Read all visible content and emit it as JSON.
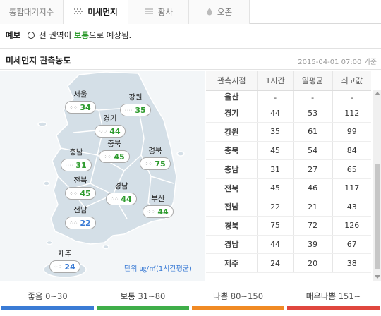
{
  "tabs": [
    {
      "label": "통합대기지수",
      "icon": "none"
    },
    {
      "label": "미세먼지",
      "icon": "dust-dots-icon"
    },
    {
      "label": "황사",
      "icon": "lines-icon"
    },
    {
      "label": "오존",
      "icon": "drop-icon"
    }
  ],
  "forecast": {
    "label": "예보",
    "prefix": "전 권역이",
    "status": "보통",
    "suffix": "으로 예상됨."
  },
  "section": {
    "title": "미세먼지 관측농도",
    "timestamp": "2015-04-01 07:00 기준"
  },
  "map": {
    "unit": "단위 ㎍/㎥(1시간평균)",
    "cities": [
      {
        "name": "서울",
        "value": "34",
        "level": "normal"
      },
      {
        "name": "강원",
        "value": "35",
        "level": "normal"
      },
      {
        "name": "경기",
        "value": "44",
        "level": "normal"
      },
      {
        "name": "충북",
        "value": "45",
        "level": "normal"
      },
      {
        "name": "충남",
        "value": "31",
        "level": "normal"
      },
      {
        "name": "경북",
        "value": "75",
        "level": "normal"
      },
      {
        "name": "전북",
        "value": "45",
        "level": "normal"
      },
      {
        "name": "경남",
        "value": "44",
        "level": "normal"
      },
      {
        "name": "부산",
        "value": "44",
        "level": "normal"
      },
      {
        "name": "전남",
        "value": "22",
        "level": "good"
      },
      {
        "name": "제주",
        "value": "24",
        "level": "good"
      }
    ]
  },
  "table": {
    "headers": [
      "관측지점",
      "1시간",
      "일평균",
      "최고값"
    ],
    "rows": [
      [
        "울산",
        "-",
        "-",
        "-"
      ],
      [
        "경기",
        "44",
        "53",
        "112"
      ],
      [
        "강원",
        "35",
        "61",
        "99"
      ],
      [
        "충북",
        "45",
        "54",
        "84"
      ],
      [
        "충남",
        "31",
        "27",
        "65"
      ],
      [
        "전북",
        "45",
        "46",
        "117"
      ],
      [
        "전남",
        "22",
        "21",
        "43"
      ],
      [
        "경북",
        "75",
        "72",
        "126"
      ],
      [
        "경남",
        "44",
        "39",
        "67"
      ],
      [
        "제주",
        "24",
        "20",
        "38"
      ]
    ]
  },
  "legend": [
    {
      "label": "좋음",
      "range": "0~30",
      "color": "#3a7bd5"
    },
    {
      "label": "보통",
      "range": "31~80",
      "color": "#3fae49"
    },
    {
      "label": "나쁨",
      "range": "80~150",
      "color": "#f08a24"
    },
    {
      "label": "매우나쁨",
      "range": "151~",
      "color": "#e0473e"
    }
  ],
  "colors": {
    "good": "#3a7bd5",
    "normal": "#2e9b2e",
    "land": "#d7e1e9",
    "sea": "#f3f6f8"
  }
}
